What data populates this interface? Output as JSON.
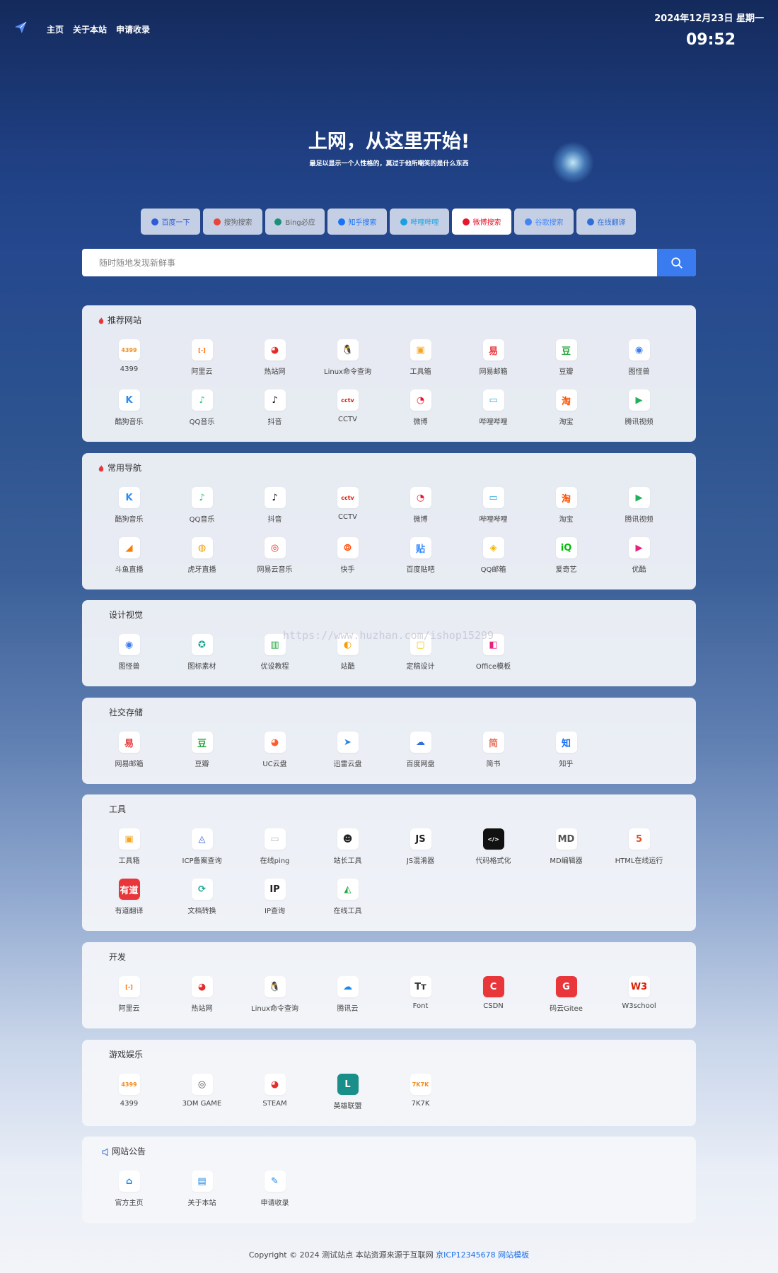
{
  "nav": {
    "links": [
      "主页",
      "关于本站",
      "申请收录"
    ],
    "date": "2024年12月23日 星期一",
    "time": "09:52"
  },
  "hero": {
    "title": "上网，从这里开始!",
    "subtitle": "最足以显示一个人性格的，莫过于他所嘲笑的是什么东西"
  },
  "search_tabs": [
    {
      "label": "百度一下",
      "icon": "paw-icon",
      "color": "#2f5bd8",
      "active": false
    },
    {
      "label": "搜狗搜索",
      "icon": "sogou-icon",
      "color": "#e8443a",
      "active": false
    },
    {
      "label": "Bing必应",
      "icon": "bing-icon",
      "color": "#1c8f76",
      "active": false
    },
    {
      "label": "知乎搜索",
      "icon": "zhihu-icon",
      "color": "#1772f6",
      "active": false
    },
    {
      "label": "哔哩哔哩",
      "icon": "bilibili-icon",
      "color": "#1aa0e0",
      "active": false
    },
    {
      "label": "微博搜索",
      "icon": "weibo-icon",
      "color": "#e6162d",
      "active": true
    },
    {
      "label": "谷歌搜索",
      "icon": "google-icon",
      "color": "#4285f4",
      "active": false
    },
    {
      "label": "在线翻译",
      "icon": "translate-icon",
      "color": "#2f6fd8",
      "active": false
    }
  ],
  "search": {
    "placeholder": "随时随地发现新鲜事"
  },
  "sections": [
    {
      "title": "推荐网站",
      "flame": true,
      "items": [
        {
          "label": "4399",
          "icon": "4399-icon",
          "glyph": "4399",
          "color": "#f08c1e"
        },
        {
          "label": "阿里云",
          "icon": "aliyun-icon",
          "glyph": "[-]",
          "color": "#ff6a00"
        },
        {
          "label": "热站网",
          "icon": "rezhan-icon",
          "glyph": "◕",
          "color": "#e52b2b"
        },
        {
          "label": "Linux命令查询",
          "icon": "linux-icon",
          "glyph": "🐧",
          "color": "#222"
        },
        {
          "label": "工具箱",
          "icon": "toolbox-icon",
          "glyph": "▣",
          "color": "#f5a623"
        },
        {
          "label": "网易邮箱",
          "icon": "netease-mail-icon",
          "glyph": "易",
          "color": "#e8363b"
        },
        {
          "label": "豆瓣",
          "icon": "douban-icon",
          "glyph": "豆",
          "color": "#2aa642"
        },
        {
          "label": "图怪兽",
          "icon": "tuguaishou-icon",
          "glyph": "◉",
          "color": "#3d7bf0"
        },
        {
          "label": "酷狗音乐",
          "icon": "kugou-icon",
          "glyph": "K",
          "color": "#2b8cf0"
        },
        {
          "label": "QQ音乐",
          "icon": "qqmusic-icon",
          "glyph": "♪",
          "color": "#31c27c"
        },
        {
          "label": "抖音",
          "icon": "douyin-icon",
          "glyph": "♪",
          "color": "#111"
        },
        {
          "label": "CCTV",
          "icon": "cctv-icon",
          "glyph": "cctv",
          "color": "#d81e06"
        },
        {
          "label": "微博",
          "icon": "weibo-icon",
          "glyph": "◔",
          "color": "#e6162d"
        },
        {
          "label": "哔哩哔哩",
          "icon": "bilibili-icon",
          "glyph": "▭",
          "color": "#23ade5"
        },
        {
          "label": "淘宝",
          "icon": "taobao-icon",
          "glyph": "淘",
          "color": "#ff5000"
        },
        {
          "label": "腾讯视频",
          "icon": "tencent-video-icon",
          "glyph": "▶",
          "color": "#20b15a"
        }
      ]
    },
    {
      "title": "常用导航",
      "flame": true,
      "items": [
        {
          "label": "酷狗音乐",
          "icon": "kugou-icon",
          "glyph": "K",
          "color": "#2b8cf0"
        },
        {
          "label": "QQ音乐",
          "icon": "qqmusic-icon",
          "glyph": "♪",
          "color": "#31c27c"
        },
        {
          "label": "抖音",
          "icon": "douyin-icon",
          "glyph": "♪",
          "color": "#111"
        },
        {
          "label": "CCTV",
          "icon": "cctv-icon",
          "glyph": "cctv",
          "color": "#d81e06"
        },
        {
          "label": "微博",
          "icon": "weibo-icon",
          "glyph": "◔",
          "color": "#e6162d"
        },
        {
          "label": "哔哩哔哩",
          "icon": "bilibili-icon",
          "glyph": "▭",
          "color": "#23ade5"
        },
        {
          "label": "淘宝",
          "icon": "taobao-icon",
          "glyph": "淘",
          "color": "#ff5000"
        },
        {
          "label": "腾讯视频",
          "icon": "tencent-video-icon",
          "glyph": "▶",
          "color": "#20b15a"
        },
        {
          "label": "斗鱼直播",
          "icon": "douyu-icon",
          "glyph": "◢",
          "color": "#ff7a00"
        },
        {
          "label": "虎牙直播",
          "icon": "huya-icon",
          "glyph": "◍",
          "color": "#f5a000"
        },
        {
          "label": "网易云音乐",
          "icon": "netease-music-icon",
          "glyph": "◎",
          "color": "#e72d2c"
        },
        {
          "label": "快手",
          "icon": "kuaishou-icon",
          "glyph": "⦾",
          "color": "#ff4906"
        },
        {
          "label": "百度贴吧",
          "icon": "tieba-icon",
          "glyph": "贴",
          "color": "#3388ff"
        },
        {
          "label": "QQ邮箱",
          "icon": "qqmail-icon",
          "glyph": "◈",
          "color": "#f5b400"
        },
        {
          "label": "爱奇艺",
          "icon": "iqiyi-icon",
          "glyph": "iQ",
          "color": "#00be06"
        },
        {
          "label": "优酷",
          "icon": "youku-icon",
          "glyph": "▶",
          "color": "#e8207e"
        }
      ]
    },
    {
      "title": "设计视觉",
      "flame": false,
      "items": [
        {
          "label": "图怪兽",
          "icon": "tuguaishou-icon",
          "glyph": "◉",
          "color": "#3d7bf0"
        },
        {
          "label": "图标素材",
          "icon": "icon-material-icon",
          "glyph": "✪",
          "color": "#1aa58f"
        },
        {
          "label": "优设教程",
          "icon": "youshe-icon",
          "glyph": "▥",
          "color": "#28a745"
        },
        {
          "label": "站酷",
          "icon": "zcool-icon",
          "glyph": "◐",
          "color": "#f5a000"
        },
        {
          "label": "定稿设计",
          "icon": "dinggao-icon",
          "glyph": "▢",
          "color": "#f5c400"
        },
        {
          "label": "Office模板",
          "icon": "office-icon",
          "glyph": "◧",
          "color": "#e8207e"
        }
      ]
    },
    {
      "title": "社交存储",
      "flame": false,
      "items": [
        {
          "label": "网易邮箱",
          "icon": "netease-mail-icon",
          "glyph": "易",
          "color": "#e8363b"
        },
        {
          "label": "豆瓣",
          "icon": "douban-icon",
          "glyph": "豆",
          "color": "#2aa642"
        },
        {
          "label": "UC云盘",
          "icon": "uc-icon",
          "glyph": "◕",
          "color": "#ff5b2b"
        },
        {
          "label": "迅雷云盘",
          "icon": "xunlei-icon",
          "glyph": "➤",
          "color": "#1e88e5"
        },
        {
          "label": "百度网盘",
          "icon": "baidu-pan-icon",
          "glyph": "☁",
          "color": "#2f6fe0"
        },
        {
          "label": "简书",
          "icon": "jianshu-icon",
          "glyph": "简",
          "color": "#ea6f5a"
        },
        {
          "label": "知乎",
          "icon": "zhihu-icon",
          "glyph": "知",
          "color": "#1772f6"
        }
      ]
    },
    {
      "title": "工具",
      "flame": false,
      "items": [
        {
          "label": "工具箱",
          "icon": "toolbox-icon",
          "glyph": "▣",
          "color": "#f5a623"
        },
        {
          "label": "ICP备案查询",
          "icon": "icp-icon",
          "glyph": "◬",
          "color": "#2f5bd8"
        },
        {
          "label": "在线ping",
          "icon": "ping-icon",
          "glyph": "▭",
          "color": "#bbb"
        },
        {
          "label": "站长工具",
          "icon": "webmaster-icon",
          "glyph": "☻",
          "color": "#222"
        },
        {
          "label": "JS混淆器",
          "icon": "js-icon",
          "glyph": "JS",
          "color": "#222"
        },
        {
          "label": "代码格式化",
          "icon": "code-format-icon",
          "glyph": "</>",
          "color": "#fff"
        },
        {
          "label": "MD编辑器",
          "icon": "md-editor-icon",
          "glyph": "MD",
          "color": "#555"
        },
        {
          "label": "HTML在线运行",
          "icon": "html5-icon",
          "glyph": "5",
          "color": "#e34c26"
        },
        {
          "label": "有道翻译",
          "icon": "youdao-icon",
          "glyph": "有道",
          "color": "#fff"
        },
        {
          "label": "文档转换",
          "icon": "doc-convert-icon",
          "glyph": "⟳",
          "color": "#1aa58f"
        },
        {
          "label": "IP查询",
          "icon": "ip-icon",
          "glyph": "IP",
          "color": "#222"
        },
        {
          "label": "在线工具",
          "icon": "online-tools-icon",
          "glyph": "◭",
          "color": "#28a745"
        }
      ]
    },
    {
      "title": "开发",
      "flame": false,
      "items": [
        {
          "label": "阿里云",
          "icon": "aliyun-icon",
          "glyph": "[-]",
          "color": "#ff6a00"
        },
        {
          "label": "热站网",
          "icon": "rezhan-icon",
          "glyph": "◕",
          "color": "#e52b2b"
        },
        {
          "label": "Linux命令查询",
          "icon": "linux-icon",
          "glyph": "🐧",
          "color": "#222"
        },
        {
          "label": "腾讯云",
          "icon": "tencent-cloud-icon",
          "glyph": "☁",
          "color": "#1e88e5"
        },
        {
          "label": "Font",
          "icon": "font-icon",
          "glyph": "Tт",
          "color": "#333"
        },
        {
          "label": "CSDN",
          "icon": "csdn-icon",
          "glyph": "C",
          "color": "#fff"
        },
        {
          "label": "码云Gitee",
          "icon": "gitee-icon",
          "glyph": "G",
          "color": "#fff"
        },
        {
          "label": "W3school",
          "icon": "w3school-icon",
          "glyph": "W3",
          "color": "#d81e06"
        }
      ]
    },
    {
      "title": "游戏娱乐",
      "flame": false,
      "items": [
        {
          "label": "4399",
          "icon": "4399-icon",
          "glyph": "4399",
          "color": "#f08c1e"
        },
        {
          "label": "3DM GAME",
          "icon": "3dm-icon",
          "glyph": "◎",
          "color": "#555"
        },
        {
          "label": "STEAM",
          "icon": "steam-icon",
          "glyph": "◕",
          "color": "#e52b2b"
        },
        {
          "label": "英雄联盟",
          "icon": "lol-icon",
          "glyph": "L",
          "color": "#fff"
        },
        {
          "label": "7K7K",
          "icon": "7k7k-icon",
          "glyph": "7K7K",
          "color": "#f08c1e"
        }
      ]
    },
    {
      "title": "网站公告",
      "flame": false,
      "speaker": true,
      "items": [
        {
          "label": "官方主页",
          "icon": "home-icon",
          "glyph": "⌂",
          "color": "#1e88e5"
        },
        {
          "label": "关于本站",
          "icon": "about-icon",
          "glyph": "▤",
          "color": "#1e88e5"
        },
        {
          "label": "申请收录",
          "icon": "apply-icon",
          "glyph": "✎",
          "color": "#1e88e5"
        }
      ]
    }
  ],
  "footer": {
    "text": "Copyright © 2024 测试站点 本站资源来源于互联网",
    "icp": "京ICP12345678",
    "template": "网站模板"
  },
  "watermark": "https://www.huzhan.com/ishop15299"
}
